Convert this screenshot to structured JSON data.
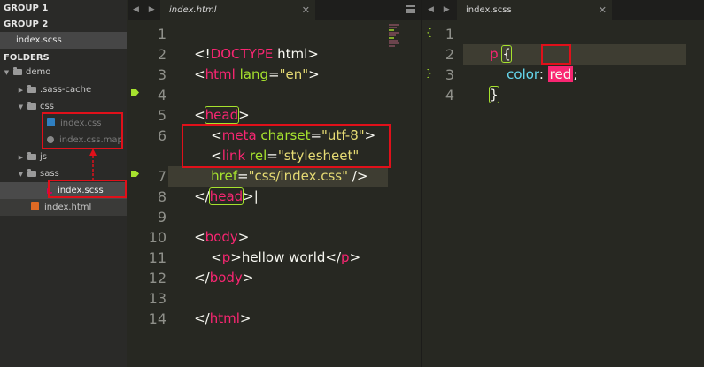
{
  "sidebar": {
    "group1": "GROUP 1",
    "group2": "GROUP 2",
    "group2_file": "index.scss",
    "folders": "FOLDERS",
    "tree": {
      "demo": "demo",
      "sass_cache": ".sass-cache",
      "css": "css",
      "index_css": "index.css",
      "index_css_map": "index.css.map",
      "js": "js",
      "sass": "sass",
      "index_scss": "index.scss",
      "index_html": "index.html"
    }
  },
  "left_pane": {
    "nav_arrows": "◀ ▶",
    "tab_label": "index.html",
    "tab_close": "✕",
    "line_numbers": [
      "1",
      "2",
      "3",
      "4",
      "5",
      "6",
      "",
      "7",
      "8",
      "9",
      "10",
      "11",
      "12",
      "13",
      "14"
    ],
    "code": {
      "l1a": "<!",
      "l1b": "DOCTYPE",
      "l1c": " html>",
      "l2a": "<",
      "l2b": "html",
      "l2c": " lang",
      "l2d": "=",
      "l2e": "\"en\"",
      "l2f": ">",
      "l4a": "<",
      "l4b": "head",
      "l4c": ">",
      "l5a": "    <",
      "l5b": "meta",
      "l5c": " charset",
      "l5d": "=",
      "l5e": "\"utf-8\"",
      "l5f": ">",
      "l6a": "    <",
      "l6b": "link",
      "l6c": " rel",
      "l6d": "=",
      "l6e": "\"stylesheet\"",
      "l6g": "    href",
      "l6h": "=",
      "l6i": "\"css/index.css\"",
      "l6j": " />",
      "l7a": "</",
      "l7b": "head",
      "l7c": ">",
      "l9a": "<",
      "l9b": "body",
      "l9c": ">",
      "l10a": "    <",
      "l10b": "p",
      "l10c": ">hellow world</",
      "l10d": "p",
      "l10e": ">",
      "l11a": "</",
      "l11b": "body",
      "l11c": ">",
      "l13a": "</",
      "l13b": "html",
      "l13c": ">"
    }
  },
  "right_pane": {
    "nav_arrows": "◀ ▶",
    "tab_label": "index.scss",
    "tab_close": "✕",
    "line_numbers": [
      "1",
      "2",
      "3",
      "4"
    ],
    "code": {
      "l1a": "p",
      "l1b": "{",
      "l2a": "    color",
      "l2b": ": ",
      "l2c": "red",
      "l2d": ";",
      "l3a": "}"
    },
    "fold_open": "{",
    "fold_close": "}"
  },
  "colors": {
    "tag": "#f92672",
    "attribute": "#a6e22e",
    "string": "#e6db74",
    "property": "#66d9ef",
    "annotation_red": "#e0101a"
  }
}
